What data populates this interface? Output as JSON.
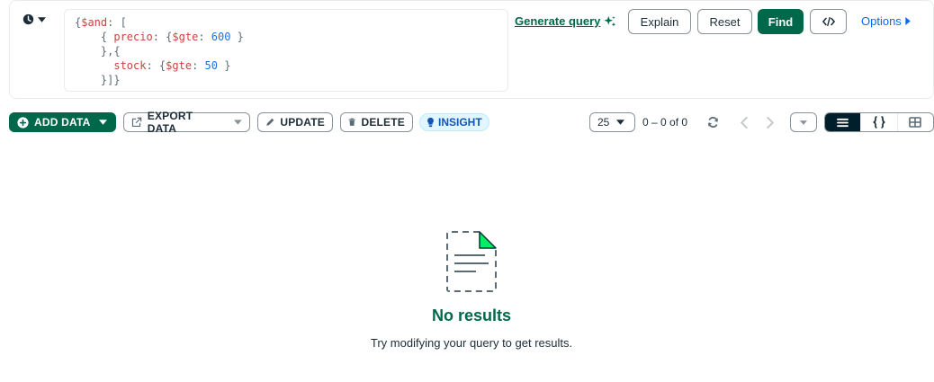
{
  "query": {
    "lines": [
      {
        "parts": [
          {
            "t": "{",
            "c": "p"
          },
          {
            "t": "$and",
            "c": "op"
          },
          {
            "t": ": [",
            "c": "p"
          }
        ]
      },
      {
        "parts": [
          {
            "t": "    { ",
            "c": "p"
          },
          {
            "t": "precio",
            "c": "key"
          },
          {
            "t": ": {",
            "c": "p"
          },
          {
            "t": "$gte",
            "c": "op"
          },
          {
            "t": ": ",
            "c": "p"
          },
          {
            "t": "600",
            "c": "num"
          },
          {
            "t": " }",
            "c": "p"
          }
        ]
      },
      {
        "parts": [
          {
            "t": "    },{",
            "c": "p"
          }
        ]
      },
      {
        "parts": [
          {
            "t": "      ",
            "c": "p"
          },
          {
            "t": "stock",
            "c": "key"
          },
          {
            "t": ": {",
            "c": "p"
          },
          {
            "t": "$gte",
            "c": "op"
          },
          {
            "t": ": ",
            "c": "p"
          },
          {
            "t": "50",
            "c": "num"
          },
          {
            "t": " }",
            "c": "p"
          }
        ]
      },
      {
        "parts": [
          {
            "t": "    }]}",
            "c": "p"
          }
        ]
      }
    ],
    "generate_query_label": "Generate query",
    "explain_label": "Explain",
    "reset_label": "Reset",
    "find_label": "Find",
    "options_label": "Options"
  },
  "toolbar": {
    "add_data_label": "ADD DATA",
    "export_data_label": "EXPORT DATA",
    "update_label": "UPDATE",
    "delete_label": "DELETE",
    "insight_label": "INSIGHT",
    "page_size": "25",
    "range_text": "0 – 0 of 0"
  },
  "empty_state": {
    "title": "No results",
    "subtitle": "Try modifying your query to get results."
  },
  "colors": {
    "brand_green": "#00684a",
    "accent_blue": "#016bf8",
    "dark": "#001e2b"
  },
  "icons": [
    "history-icon",
    "caret-down-icon",
    "sparkle-icon",
    "code-icon",
    "caret-right-icon",
    "plus-circle-icon",
    "export-icon",
    "pencil-icon",
    "trash-icon",
    "bulb-icon",
    "refresh-icon",
    "chevron-left-icon",
    "chevron-right-icon",
    "list-view-icon",
    "json-view-icon",
    "table-view-icon",
    "empty-document-icon"
  ]
}
